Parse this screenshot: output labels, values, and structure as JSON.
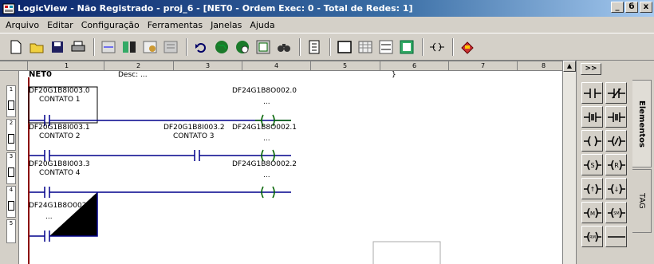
{
  "window": {
    "title": "LogicView - Não Registrado - proj_6 - [NET0 - Ordem Exec: 0 - Total de Redes: 1]",
    "controls": [
      "_",
      "б",
      "x"
    ]
  },
  "menu": {
    "items": [
      "Arquivo",
      "Editar",
      "Configuração",
      "Ferramentas",
      "Janelas",
      "Ajuda"
    ]
  },
  "toolbar": {
    "buttons": [
      "new-file-icon",
      "open-folder-icon",
      "save-disk-icon",
      "print-icon",
      "ladder-view-icon",
      "fbd-view-icon",
      "compile-icon",
      "config-icon",
      "undo-icon",
      "globe-icon",
      "globe-refresh-icon",
      "hardware-icon",
      "find-icon",
      "function-block-icon",
      "rect-icon",
      "grid-icon",
      "net1-net2-icon",
      "tag-table-icon",
      "coil-insert-icon",
      "erase-icon"
    ]
  },
  "ruler": {
    "marks": [
      "1",
      "2",
      "3",
      "4",
      "5",
      "6",
      "7",
      "8"
    ]
  },
  "editor": {
    "net_name": "NET0",
    "desc_label": "Desc: ...",
    "desc_end": "}",
    "rows": [
      "1",
      "2",
      "3",
      "4",
      "5"
    ],
    "contacts": [
      {
        "tag": "DF20G1B8I003.0",
        "name": "CONTATO 1"
      },
      {
        "tag": "DF20G1B8I003.1",
        "name": "CONTATO 2"
      },
      {
        "tag": "DF20G1B8I003.2",
        "name": "CONTATO 3"
      },
      {
        "tag": "DF20G1B8I003.3",
        "name": "CONTATO 4"
      },
      {
        "tag": "DF24G1B8O002.2",
        "name": "..."
      }
    ],
    "coils": [
      {
        "tag": "DF24G1B8O002.0",
        "name": "..."
      },
      {
        "tag": "DF24G1B8O002.1",
        "name": "..."
      },
      {
        "tag": "DF24G1B8O002.2",
        "name": "..."
      }
    ]
  },
  "panel": {
    "expand_button": ">>",
    "tabs": [
      "Elementos",
      "TAG"
    ],
    "palette": [
      "no-contact-icon",
      "nc-contact-icon",
      "pos-transition-contact-icon",
      "neg-transition-contact-icon",
      "coil-icon",
      "negated-coil-icon",
      "set-coil-icon",
      "reset-coil-icon",
      "pos-transition-coil-icon",
      "neg-transition-coil-icon",
      "memory-coil-icon",
      "set-memory-coil-icon",
      "reset-memory-coil-icon",
      "horizontal-wire-icon"
    ],
    "palette_texts": [
      "S",
      "R",
      "↑",
      "↓",
      "M",
      "SM",
      "RM"
    ]
  },
  "colors": {
    "rail": "#8b0000",
    "wire": "#00008b",
    "coil": "#006400",
    "title_start": "#0a246a"
  }
}
